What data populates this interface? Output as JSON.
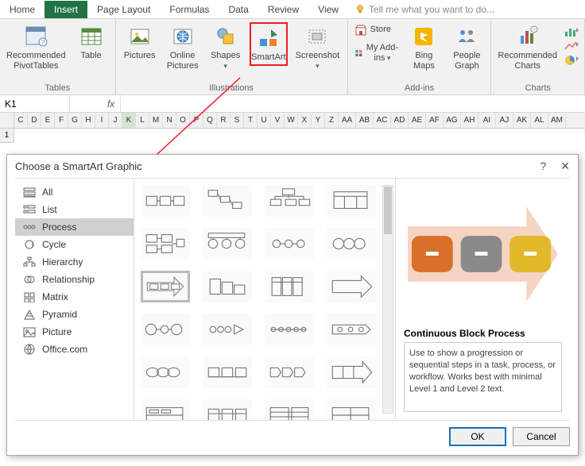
{
  "tabs": [
    "Home",
    "Insert",
    "Page Layout",
    "Formulas",
    "Data",
    "Review",
    "View"
  ],
  "active_tab": 1,
  "tell_me": "Tell me what you want to do...",
  "groups": {
    "tables": {
      "label": "Tables",
      "pivot": "Recommended\nPivotTables",
      "table": "Table"
    },
    "illus": {
      "label": "Illustrations",
      "pictures": "Pictures",
      "online": "Online\nPictures",
      "shapes": "Shapes",
      "smartart": "SmartArt",
      "screenshot": "Screenshot"
    },
    "addins": {
      "label": "Add-ins",
      "store": "Store",
      "my": "My Add-ins",
      "bing": "Bing\nMaps",
      "people": "People\nGraph"
    },
    "charts": {
      "label": "Charts",
      "rec": "Recommended\nCharts"
    }
  },
  "namebox": "K1",
  "columns": [
    "C",
    "D",
    "E",
    "F",
    "G",
    "H",
    "I",
    "J",
    "K",
    "L",
    "M",
    "N",
    "O",
    "P",
    "Q",
    "R",
    "S",
    "T",
    "U",
    "V",
    "W",
    "X",
    "Y",
    "Z",
    "AA",
    "AB",
    "AC",
    "AD",
    "AE",
    "AF",
    "AG",
    "AH",
    "AI",
    "AJ",
    "AK",
    "AL",
    "AM"
  ],
  "sel_col": "K",
  "row1": "1",
  "dialog": {
    "title": "Choose a SmartArt Graphic",
    "help": "?",
    "close": "✕",
    "categories": [
      "All",
      "List",
      "Process",
      "Cycle",
      "Hierarchy",
      "Relationship",
      "Matrix",
      "Pyramid",
      "Picture",
      "Office.com"
    ],
    "sel_cat": 2,
    "preview_title": "Continuous Block Process",
    "preview_desc": "Use to show a progression or sequential steps in a task, process, or workflow. Works best with minimal Level 1 and Level 2 text.",
    "ok": "OK",
    "cancel": "Cancel"
  }
}
